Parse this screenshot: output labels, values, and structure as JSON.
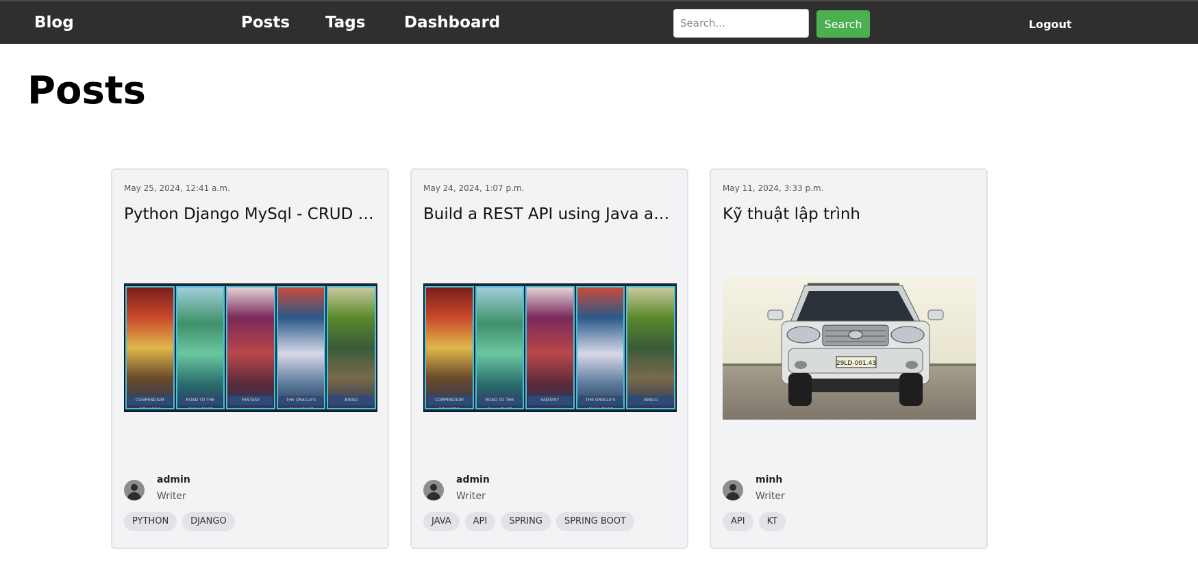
{
  "nav": {
    "brand": "Blog",
    "links": [
      "Posts",
      "Tags",
      "Dashboard"
    ],
    "search_placeholder": "Search...",
    "search_button": "Search",
    "logout": "Logout"
  },
  "page": {
    "title": "Posts"
  },
  "posts": [
    {
      "date": "May 25, 2024, 12:41 a.m.",
      "title": "Python Django MySql - CRUD c...",
      "image": "stained-glass-panels",
      "image_captions": [
        "COMPENDIUM REWARDS",
        "ROAD TO THE CHALLENGE",
        "FANTASY",
        "THE ORACLE'S CHALLENGE",
        "BINGO"
      ],
      "author": "admin",
      "role": "Writer",
      "tags": [
        "PYTHON",
        "DJANGO"
      ]
    },
    {
      "date": "May 24, 2024, 1:07 p.m.",
      "title": "Build a REST API using Java and...",
      "image": "stained-glass-panels",
      "image_captions": [
        "COMPENDIUM REWARDS",
        "ROAD TO THE CHALLENGE",
        "FANTASY",
        "THE ORACLE'S CHALLENGE",
        "BINGO"
      ],
      "author": "admin",
      "role": "Writer",
      "tags": [
        "JAVA",
        "API",
        "SPRING",
        "SPRING BOOT"
      ]
    },
    {
      "date": "May 11, 2024, 3:33 p.m.",
      "title": "Kỹ thuật lập trình",
      "image": "white-suv-photo",
      "plate": "29LD-001.43",
      "author": "minh",
      "role": "Writer",
      "tags": [
        "API",
        "KT"
      ]
    }
  ],
  "colors": {
    "navbar": "#2f2f2f",
    "search_button": "#4caf50",
    "card_bg": "#f2f3f5",
    "tag_bg": "#e1e3e7"
  }
}
